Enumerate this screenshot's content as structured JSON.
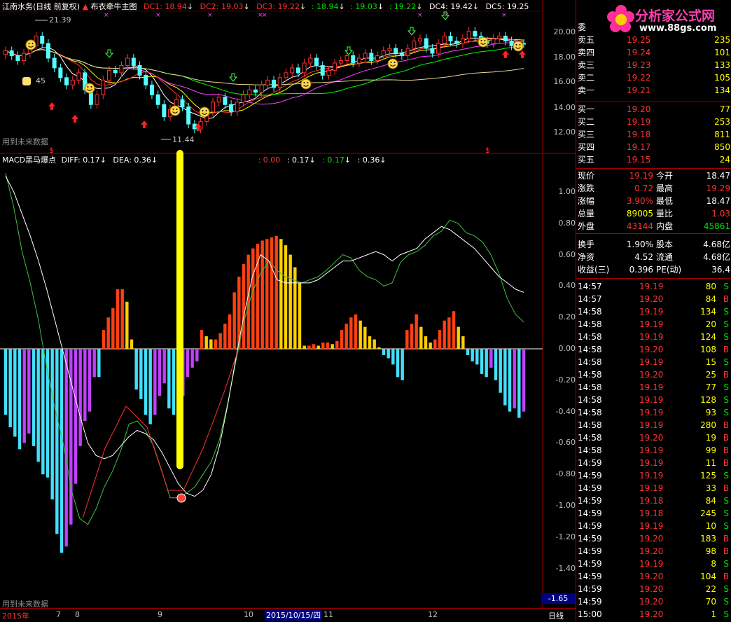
{
  "header": {
    "stock": "江南水务(日线 前复权)",
    "indicator": "布衣牵牛主图",
    "dc1": "DC1: 18.94",
    "dc2": "DC2: 19.03",
    "dc3": "DC3: 19.22",
    "v1": ": 18.94",
    "v2": ": 19.03",
    "v3": ": 19.22",
    "dc4": "DC4: 19.42",
    "dc5": "DC5: 19.25"
  },
  "top_pane": {
    "yticks": [
      "20.00",
      "18.00",
      "16.00",
      "14.00",
      "12.00"
    ],
    "high_label": "21.39",
    "low_label": "11.44",
    "left_label": "45",
    "future_note": "用到未来数据",
    "dollar1": "$",
    "dollar2": "$"
  },
  "macd_pane": {
    "title": "MACD黑马爆点",
    "diff": "DIFF: 0.17",
    "dea": "DEA: 0.36",
    "r1": ": 0.00",
    "r2": ": 0.17",
    "r3": ": 0.17",
    "r4": ": 0.36",
    "yticks": [
      "1.00",
      "0.80",
      "0.60",
      "0.40",
      "0.20",
      "0.00",
      "-0.20",
      "-0.40",
      "-0.60",
      "-0.80",
      "-1.00",
      "-1.20",
      "-1.40"
    ],
    "cursor_value": "-1.65",
    "future_note": "用到未来数据"
  },
  "date_axis": {
    "year": "2015年",
    "labels": [
      "7",
      "8",
      "9",
      "10",
      "11",
      "12"
    ],
    "selected": "2015/10/15/四",
    "period": "日线"
  },
  "logo": {
    "title": "分析家公式网",
    "url": "www.88gs.com"
  },
  "quote": {
    "weibi_label": "委",
    "sell": [
      {
        "label": "卖五",
        "price": "19.25",
        "vol": "235"
      },
      {
        "label": "卖四",
        "price": "19.24",
        "vol": "101"
      },
      {
        "label": "卖三",
        "price": "19.23",
        "vol": "133"
      },
      {
        "label": "卖二",
        "price": "19.22",
        "vol": "105"
      },
      {
        "label": "卖一",
        "price": "19.21",
        "vol": "134"
      }
    ],
    "buy": [
      {
        "label": "买一",
        "price": "19.20",
        "vol": "77"
      },
      {
        "label": "买二",
        "price": "19.19",
        "vol": "253"
      },
      {
        "label": "买三",
        "price": "19.18",
        "vol": "811"
      },
      {
        "label": "买四",
        "price": "19.17",
        "vol": "850"
      },
      {
        "label": "买五",
        "price": "19.15",
        "vol": "24"
      }
    ],
    "stats1": [
      {
        "l1": "现价",
        "v1": "19.19",
        "l2": "今开",
        "v2": "18.47",
        "c1": "red",
        "c2": "wht"
      },
      {
        "l1": "涨跌",
        "v1": "0.72",
        "l2": "最高",
        "v2": "19.29",
        "c1": "red",
        "c2": "red"
      },
      {
        "l1": "涨幅",
        "v1": "3.90%",
        "l2": "最低",
        "v2": "18.47",
        "c1": "red",
        "c2": "wht"
      },
      {
        "l1": "总量",
        "v1": "89005",
        "l2": "量比",
        "v2": "1.03",
        "c1": "yel",
        "c2": "red"
      },
      {
        "l1": "外盘",
        "v1": "43144",
        "l2": "内盘",
        "v2": "45861",
        "c1": "red",
        "c2": "grn"
      }
    ],
    "stats2": [
      {
        "l1": "换手",
        "v1": "1.90%",
        "l2": "股本",
        "v2": "4.68亿"
      },
      {
        "l1": "净资",
        "v1": "4.52",
        "l2": "流通",
        "v2": "4.68亿"
      },
      {
        "l1": "收益(三)",
        "v1": "0.396",
        "l2": "PE(动)",
        "v2": "36.4"
      }
    ],
    "ticks": [
      {
        "t": "14:57",
        "p": "19.19",
        "v": "80",
        "s": "S"
      },
      {
        "t": "14:57",
        "p": "19.20",
        "v": "84",
        "s": "B"
      },
      {
        "t": "14:58",
        "p": "19.19",
        "v": "134",
        "s": "S"
      },
      {
        "t": "14:58",
        "p": "19.19",
        "v": "20",
        "s": "S"
      },
      {
        "t": "14:58",
        "p": "19.19",
        "v": "124",
        "s": "S"
      },
      {
        "t": "14:58",
        "p": "19.20",
        "v": "108",
        "s": "B"
      },
      {
        "t": "14:58",
        "p": "19.19",
        "v": "15",
        "s": "S"
      },
      {
        "t": "14:58",
        "p": "19.20",
        "v": "25",
        "s": "B"
      },
      {
        "t": "14:58",
        "p": "19.19",
        "v": "77",
        "s": "S"
      },
      {
        "t": "14:58",
        "p": "19.19",
        "v": "128",
        "s": "S"
      },
      {
        "t": "14:58",
        "p": "19.19",
        "v": "93",
        "s": "S"
      },
      {
        "t": "14:58",
        "p": "19.19",
        "v": "280",
        "s": "B"
      },
      {
        "t": "14:58",
        "p": "19.20",
        "v": "19",
        "s": "B"
      },
      {
        "t": "14:58",
        "p": "19.19",
        "v": "99",
        "s": "B"
      },
      {
        "t": "14:59",
        "p": "19.19",
        "v": "11",
        "s": "B"
      },
      {
        "t": "14:59",
        "p": "19.19",
        "v": "125",
        "s": "S"
      },
      {
        "t": "14:59",
        "p": "19.19",
        "v": "33",
        "s": "B"
      },
      {
        "t": "14:59",
        "p": "19.18",
        "v": "84",
        "s": "S"
      },
      {
        "t": "14:59",
        "p": "19.18",
        "v": "245",
        "s": "S"
      },
      {
        "t": "14:59",
        "p": "19.19",
        "v": "10",
        "s": "S"
      },
      {
        "t": "14:59",
        "p": "19.20",
        "v": "183",
        "s": "B"
      },
      {
        "t": "14:59",
        "p": "19.20",
        "v": "98",
        "s": "B"
      },
      {
        "t": "14:59",
        "p": "19.19",
        "v": "8",
        "s": "S"
      },
      {
        "t": "14:59",
        "p": "19.20",
        "v": "104",
        "s": "B"
      },
      {
        "t": "14:59",
        "p": "19.20",
        "v": "22",
        "s": "S"
      },
      {
        "t": "14:59",
        "p": "19.20",
        "v": "70",
        "s": "S"
      },
      {
        "t": "15:00",
        "p": "19.20",
        "v": "1",
        "s": "S"
      }
    ]
  },
  "chart_data": [
    {
      "type": "candlestick",
      "ylim": [
        11,
        21.5
      ],
      "close": [
        18.6,
        18.2,
        17.8,
        18.4,
        19.0,
        19.8,
        19.2,
        18.0,
        17.2,
        16.4,
        15.8,
        16.2,
        16.8,
        15.4,
        14.2,
        15.0,
        16.2,
        17.0,
        16.8,
        17.4,
        18.0,
        17.4,
        16.6,
        15.8,
        15.0,
        14.2,
        13.2,
        13.8,
        14.6,
        14.0,
        12.6,
        12.2,
        12.8,
        13.6,
        14.4,
        14.8,
        14.2,
        13.6,
        14.4,
        15.0,
        15.4,
        15.2,
        15.8,
        16.2,
        15.6,
        16.4,
        16.8,
        17.2,
        16.8,
        17.6,
        18.0,
        17.4,
        16.6,
        17.0,
        17.6,
        17.8,
        18.2,
        17.6,
        18.0,
        18.4,
        17.8,
        18.2,
        18.6,
        18.8,
        18.4,
        18.2,
        18.8,
        19.4,
        19.6,
        18.8,
        18.4,
        19.2,
        19.8,
        19.4,
        19.2,
        19.6,
        20.2,
        19.8,
        19.4,
        19.2,
        19.6,
        19.8,
        19.4,
        19.0,
        19.2,
        19.19
      ],
      "high": 21.39,
      "low": 11.44
    },
    {
      "type": "bar",
      "title": "MACD黑马爆点",
      "ylim": [
        -1.65,
        1.15
      ],
      "values": [
        -0.42,
        -0.5,
        -0.56,
        -0.64,
        -0.6,
        -0.54,
        -0.62,
        -0.72,
        -0.8,
        -0.82,
        -0.96,
        -1.18,
        -1.3,
        -1.26,
        -1.12,
        -0.86,
        -0.62,
        -0.46,
        -0.4,
        -0.18,
        -0.18,
        0.12,
        0.2,
        0.26,
        0.38,
        0.38,
        0.3,
        0.06,
        -0.26,
        -0.32,
        -0.42,
        -0.48,
        -0.42,
        -0.3,
        -0.22,
        -0.38,
        -0.42,
        -0.36,
        -0.3,
        -0.18,
        -0.12,
        -0.08,
        0.12,
        0.08,
        0.06,
        0.06,
        0.1,
        0.16,
        0.22,
        0.36,
        0.46,
        0.54,
        0.6,
        0.64,
        0.67,
        0.69,
        0.7,
        0.71,
        0.72,
        0.7,
        0.66,
        0.6,
        0.52,
        0.42,
        0.02,
        0.02,
        0.03,
        0.02,
        0.04,
        0.04,
        0.03,
        0.05,
        0.12,
        0.16,
        0.2,
        0.22,
        0.18,
        0.14,
        0.08,
        0.06,
        0.01,
        -0.04,
        -0.06,
        -0.1,
        -0.18,
        -0.2
      ],
      "values_tail": [
        0.12,
        0.16,
        0.22,
        0.14,
        0.08,
        0.04,
        0.06,
        0.12,
        0.18,
        0.2,
        0.24,
        0.14,
        0.08,
        -0.04,
        -0.08,
        -0.1,
        -0.16,
        -0.18,
        -0.12,
        -0.2,
        -0.28,
        -0.36,
        -0.4,
        -0.38,
        -0.44,
        -0.4
      ],
      "diff": [
        1.12,
        0.9,
        0.62,
        0.42,
        0.18,
        -0.12,
        -0.38,
        -0.6,
        -0.9,
        -1.08,
        -1.12,
        -1.02,
        -0.88,
        -0.78,
        -0.65,
        -0.48,
        -0.46,
        -0.52,
        -0.62,
        -0.78,
        -0.95,
        -0.95,
        -0.92,
        -0.88,
        -0.8,
        -0.72,
        -0.58,
        -0.35,
        -0.08,
        0.18,
        0.36,
        0.48,
        0.56,
        0.5,
        0.46,
        0.44,
        0.42,
        0.44,
        0.46,
        0.5,
        0.55,
        0.6,
        0.58,
        0.5,
        0.46,
        0.44,
        0.4,
        0.42,
        0.55,
        0.6,
        0.62,
        0.66,
        0.72,
        0.75,
        0.82,
        0.8,
        0.74,
        0.72,
        0.68,
        0.6,
        0.48,
        0.32,
        0.22,
        0.17
      ],
      "dea": [
        1.1,
        1.0,
        0.86,
        0.72,
        0.56,
        0.38,
        0.18,
        -0.02,
        -0.22,
        -0.42,
        -0.6,
        -0.68,
        -0.7,
        -0.68,
        -0.62,
        -0.56,
        -0.52,
        -0.54,
        -0.58,
        -0.66,
        -0.76,
        -0.86,
        -0.92,
        -0.94,
        -0.9,
        -0.8,
        -0.62,
        -0.36,
        -0.06,
        0.22,
        0.46,
        0.6,
        0.56,
        0.44,
        0.42,
        0.42,
        0.42,
        0.42,
        0.44,
        0.48,
        0.52,
        0.56,
        0.56,
        0.58,
        0.6,
        0.62,
        0.6,
        0.56,
        0.6,
        0.62,
        0.64,
        0.7,
        0.74,
        0.78,
        0.76,
        0.72,
        0.68,
        0.64,
        0.58,
        0.52,
        0.46,
        0.42,
        0.38,
        0.36
      ],
      "series": [
        {
          "name": "DIFF"
        },
        {
          "name": "DEA"
        }
      ]
    }
  ]
}
